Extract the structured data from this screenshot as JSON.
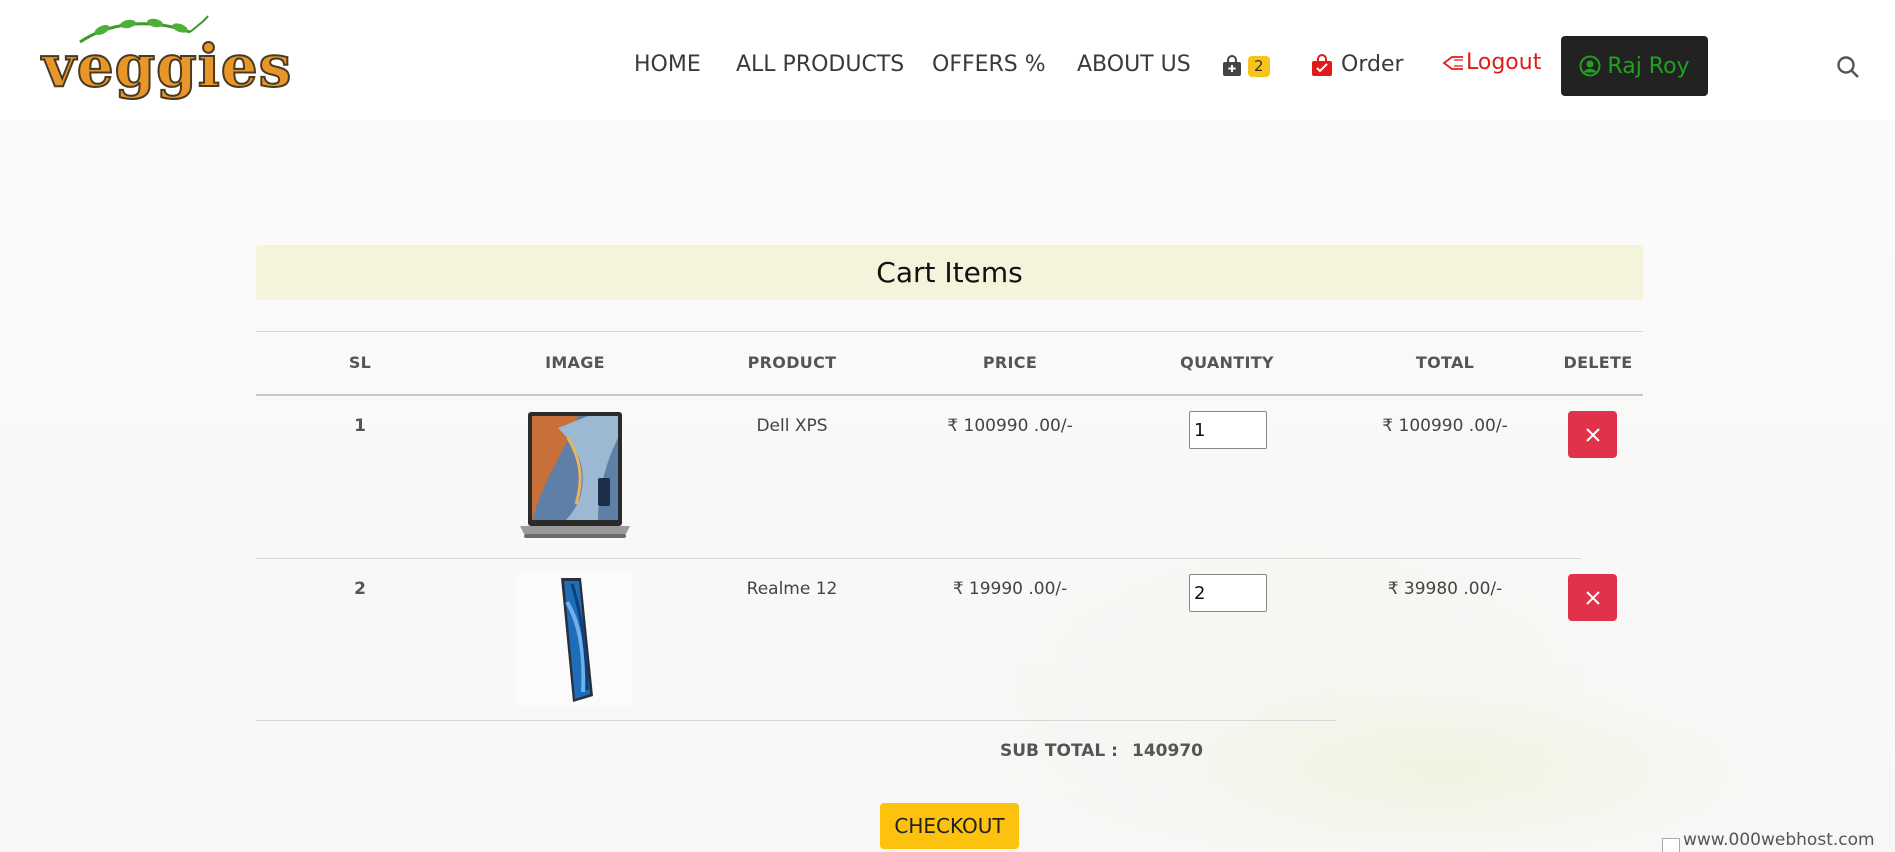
{
  "header": {
    "logo_text": "veggies",
    "nav": [
      {
        "label": "HOME"
      },
      {
        "label": "ALL PRODUCTS"
      },
      {
        "label": "OFFERS %"
      },
      {
        "label": "ABOUT US"
      }
    ],
    "cart_count": "2",
    "order_label": "Order",
    "logout_label": "Logout",
    "user_name": "Raj Roy"
  },
  "cart": {
    "title": "Cart Items",
    "columns": [
      "SL",
      "IMAGE",
      "PRODUCT",
      "PRICE",
      "QUANTITY",
      "TOTAL",
      "DELETE"
    ],
    "rows": [
      {
        "sl": "1",
        "product": "Dell XPS",
        "price": "₹ 100990 .00/-",
        "quantity": "1",
        "total": "₹ 100990 .00/-",
        "image_icon": "laptop-image"
      },
      {
        "sl": "2",
        "product": "Realme 12",
        "price": "₹ 19990 .00/-",
        "quantity": "2",
        "total": "₹ 39980 .00/-",
        "image_icon": "phone-image"
      }
    ],
    "subtotal_label": "SUB TOTAL :",
    "subtotal_value": "140970",
    "checkout_label": "CHECKOUT"
  },
  "footer": {
    "host_text": "www.000webhost.com"
  },
  "colors": {
    "accent_yellow": "#fcc20d",
    "delete_red": "#e03248",
    "logout_red": "#e21a1a",
    "user_green": "#1fa21f",
    "title_bar": "#f4f4dc"
  }
}
